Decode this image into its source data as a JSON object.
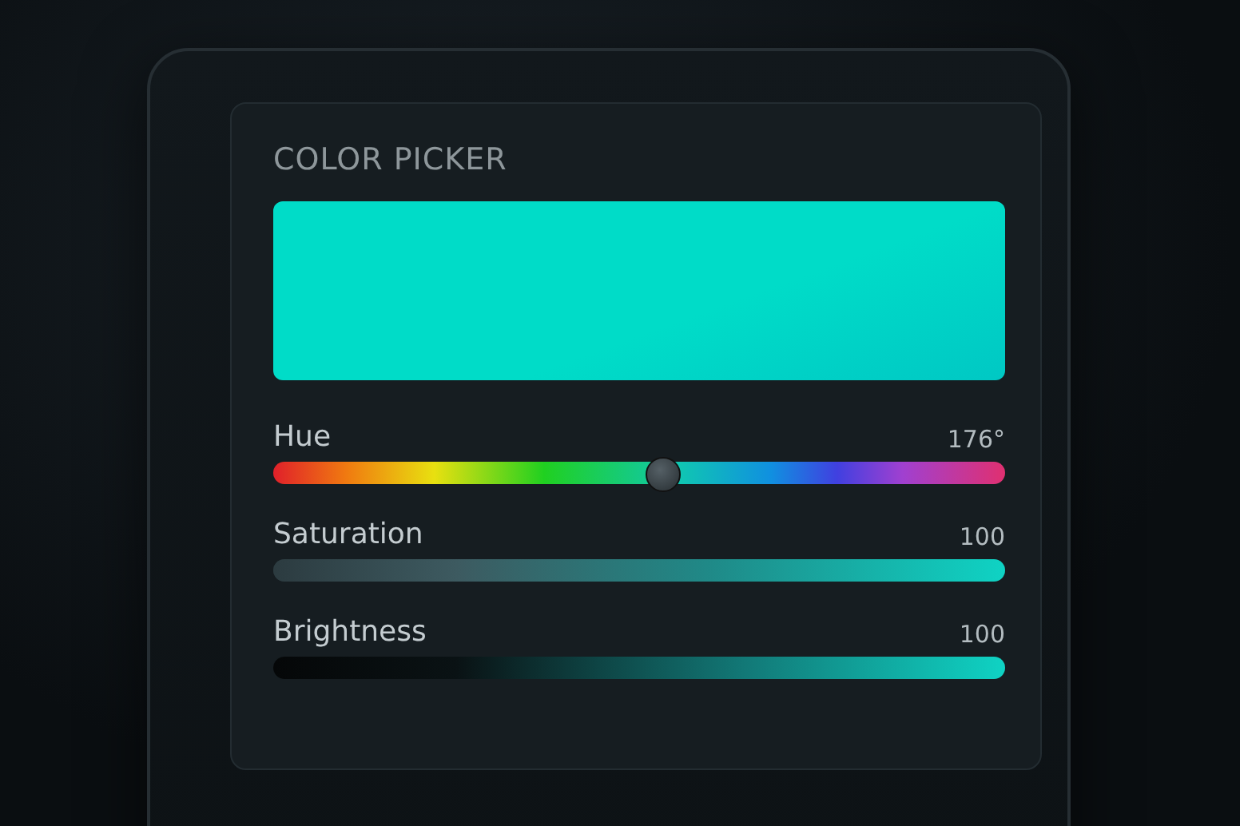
{
  "title": "COLOR PICKER",
  "swatch": {
    "color": "#00dcc8"
  },
  "sliders": [
    {
      "label": "Hue",
      "reading": "176°",
      "kind": "hue",
      "level": 0.53
    },
    {
      "label": "Saturation",
      "reading": "100",
      "kind": "saturation",
      "level": 1
    },
    {
      "label": "Brightness",
      "reading": "100",
      "kind": "brightness",
      "level": 1
    }
  ]
}
